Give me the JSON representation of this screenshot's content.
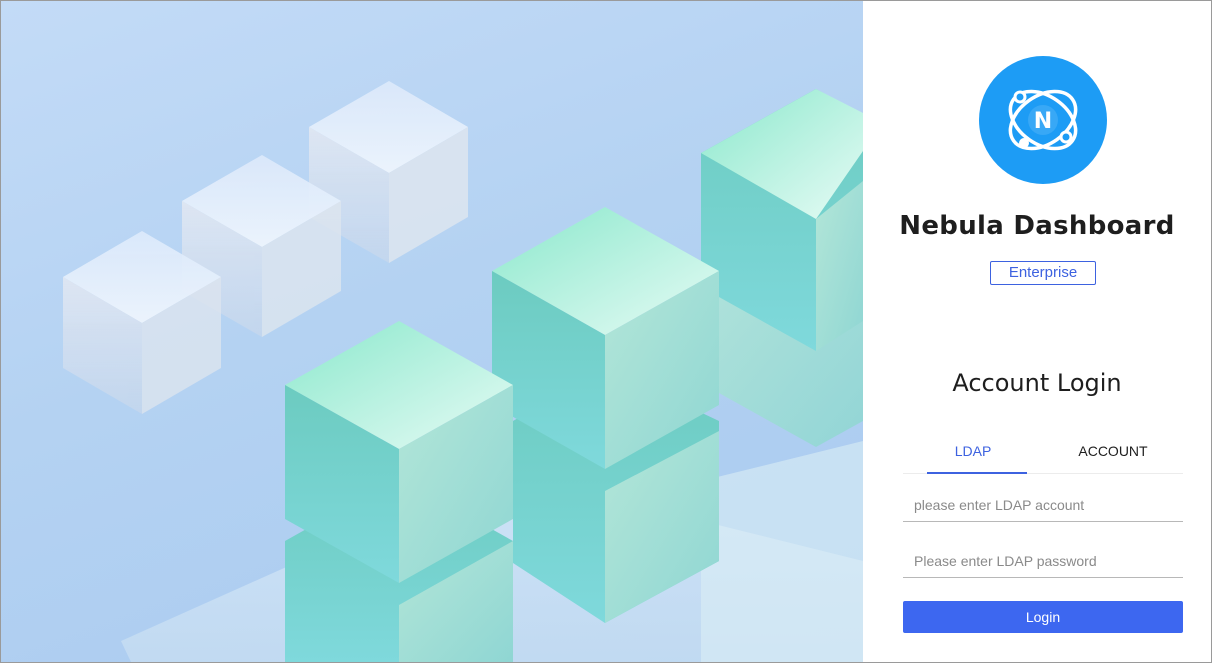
{
  "app": {
    "title": "Nebula Dashboard",
    "edition": "Enterprise",
    "logo_letter": "N"
  },
  "login": {
    "heading": "Account Login",
    "tabs": [
      {
        "label": "LDAP",
        "active": true
      },
      {
        "label": "ACCOUNT",
        "active": false
      }
    ],
    "username_placeholder": "please enter LDAP account",
    "password_placeholder": "Please enter LDAP password",
    "submit_label": "Login"
  },
  "colors": {
    "accent": "#3d67f0",
    "logo": "#1d9cf5",
    "title": "#1e1e1e"
  },
  "icons": {
    "logo": "nebula-orbit-logo-icon"
  }
}
